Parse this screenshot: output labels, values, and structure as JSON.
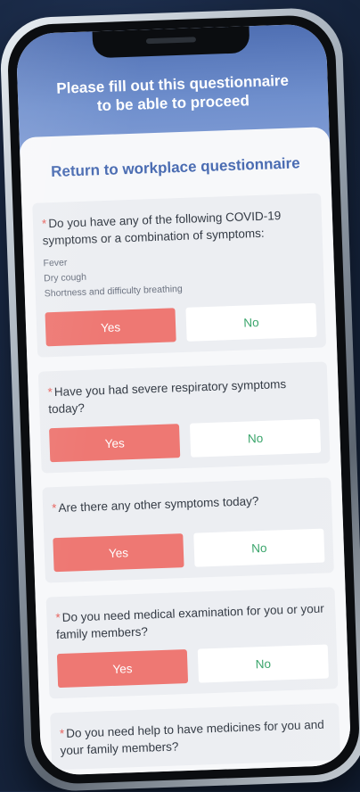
{
  "header": {
    "instruction": "Please fill out this questionnaire to be able to proceed"
  },
  "form": {
    "title": "Return to workplace questionnaire",
    "required_marker": "*",
    "questions": [
      {
        "text": "Do you have any of the following COVID-19 symptoms or a combination of symptoms:",
        "symptoms": [
          "Fever",
          "Dry cough",
          "Shortness and difficulty breathing"
        ],
        "yes_label": "Yes",
        "no_label": "No"
      },
      {
        "text": "Have you had severe respiratory symptoms today?",
        "yes_label": "Yes",
        "no_label": "No"
      },
      {
        "text": "Are there any other symptoms today?",
        "yes_label": "Yes",
        "no_label": "No"
      },
      {
        "text": "Do you need medical examination for you or your family members?",
        "yes_label": "Yes",
        "no_label": "No"
      },
      {
        "text": "Do you need help to have medicines for you and your family members?"
      }
    ]
  },
  "colors": {
    "header_top": "#4f6fb3",
    "header_bottom": "#7f9bd4",
    "title": "#4a6cb2",
    "yes_button": "#ee7873",
    "no_text": "#3aa56b",
    "required_marker": "#e8635e",
    "background": "#172640"
  }
}
